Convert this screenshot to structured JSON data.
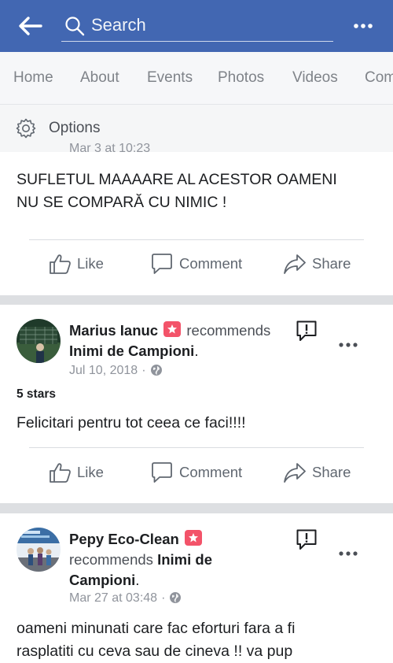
{
  "header": {
    "search_placeholder": "Search",
    "back_icon": "back-arrow-icon",
    "more_icon": "more-horizontal-icon",
    "bar_color": "#4267b2"
  },
  "tabs": [
    {
      "label": "Home"
    },
    {
      "label": "About"
    },
    {
      "label": "Events"
    },
    {
      "label": "Photos"
    },
    {
      "label": "Videos"
    },
    {
      "label": "Com"
    }
  ],
  "options": {
    "label": "Options",
    "icon": "gear-icon"
  },
  "posts": [
    {
      "timestamp_partial": "Mar 3 at 10:23",
      "text_line1": "SUFLETUL MAAAARE AL ACESTOR OAMENI",
      "text_line2": "NU SE COMPARĂ CU NIMIC !"
    },
    {
      "author": "Marius Ianuc",
      "recommends": "recommends",
      "page": "Inimi de Campioni",
      "period": ".",
      "date": "Jul 10, 2018",
      "dot": "·",
      "rating": "5 stars",
      "text": "Felicitari pentru tot ceea ce faci!!!!"
    },
    {
      "author": "Pepy Eco-Clean",
      "recommends": "recommends",
      "page_part1": "Inimi de",
      "page_part2": "Campioni",
      "period": ".",
      "date": "Mar 27 at 03:48",
      "dot": "·",
      "text_line1": "oameni minunati  care fac eforturi fara a  fi",
      "text_line2": "rasplatiti cu ceva   sau de cineva !! va pup"
    }
  ],
  "actions": {
    "like": "Like",
    "comment": "Comment",
    "share": "Share"
  }
}
